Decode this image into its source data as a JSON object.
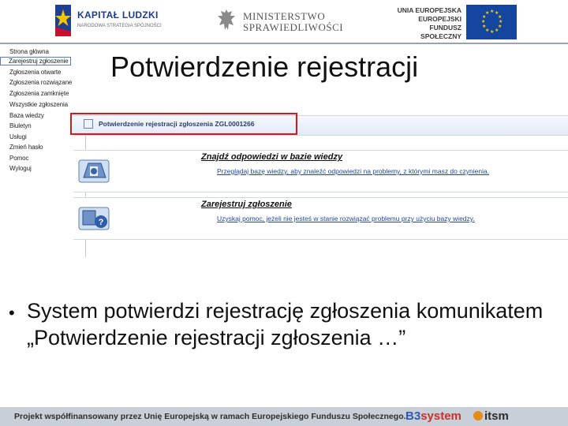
{
  "header": {
    "kapital_title": "KAPITAŁ LUDZKI",
    "kapital_sub": "NARODOWA STRATEGIA SPÓJNOŚCI",
    "ministry_line1": "MINISTERSTWO",
    "ministry_line2": "SPRAWIEDLIWOŚCI",
    "eu_line1": "UNIA EUROPEJSKA",
    "eu_line2": "EUROPEJSKI",
    "eu_line3": "FUNDUSZ SPOŁECZNY"
  },
  "slide_title": "Potwierdzenie rejestracji",
  "sidebar": {
    "items": [
      {
        "label": "Strona główna"
      },
      {
        "label": "Zarejestruj zgłoszenie",
        "selected": true
      },
      {
        "label": "Zgłoszenia otwarte"
      },
      {
        "label": "Zgłoszenia rozwiązane"
      },
      {
        "label": "Zgłoszenia zamknięte"
      },
      {
        "label": "Wszystkie zgłoszenia"
      },
      {
        "label": "Baza wiedzy"
      },
      {
        "label": "Biuletyn"
      },
      {
        "label": "Usługi"
      },
      {
        "label": "Zmień hasło"
      },
      {
        "label": "Pomoc"
      },
      {
        "label": "Wyloguj"
      }
    ]
  },
  "confirmation": {
    "text": "Potwierdzenie rejestracji zgłoszenia ZGL0001266",
    "highlight_color": "#e0141e"
  },
  "cards": [
    {
      "heading": "Znajdź odpowiedzi w bazie wiedzy",
      "description": "Przeglądaj bazę wiedzy, aby znaleźć odpowiedzi na problemy, z którymi masz do czynienia.",
      "icon": "knowledge-base-icon"
    },
    {
      "heading": "Zarejestruj zgłoszenie",
      "description": "Uzyskaj pomoc, jeżeli nie jesteś w stanie rozwiązać problemu przy użyciu bazy wiedzy.",
      "icon": "help-request-icon"
    }
  ],
  "bullet": "System potwierdzi rejestrację zgłoszenia komunikatem „Potwierdzenie rejestracji zgłoszenia …”",
  "footer": {
    "text": "Projekt współfinansowany przez Unię Europejską w ramach Europejskiego Funduszu Społecznego.",
    "b3_b": "B3",
    "b3_s": "system",
    "itsm": "itsm"
  }
}
